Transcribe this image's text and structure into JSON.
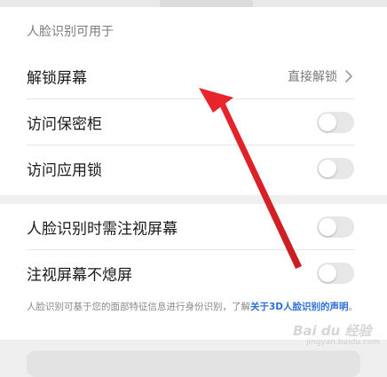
{
  "section": {
    "title": "人脸识别可用于"
  },
  "rows": [
    {
      "label": "解锁屏幕",
      "value": "直接解锁",
      "control": "chevron"
    },
    {
      "label": "访问保密柜",
      "control": "toggle",
      "on": false
    },
    {
      "label": "访问应用锁",
      "control": "toggle",
      "on": false
    }
  ],
  "rows2": [
    {
      "label": "人脸识别时需注视屏幕",
      "control": "toggle",
      "on": false
    },
    {
      "label": "注视屏幕不熄屏",
      "control": "toggle",
      "on": false
    }
  ],
  "note": {
    "text": "人脸识别可基于您的面部特征信息进行身份识别，了解",
    "link": "关于3D人脸识别的声明",
    "end": "。"
  },
  "watermark": {
    "main": "Bai du 经验",
    "sub": "jingyan.baidu.com"
  },
  "colors": {
    "accent_link": "#2e6fd6",
    "annotation_arrow": "#e8252b",
    "toggle_off": "#e7e7e7"
  }
}
